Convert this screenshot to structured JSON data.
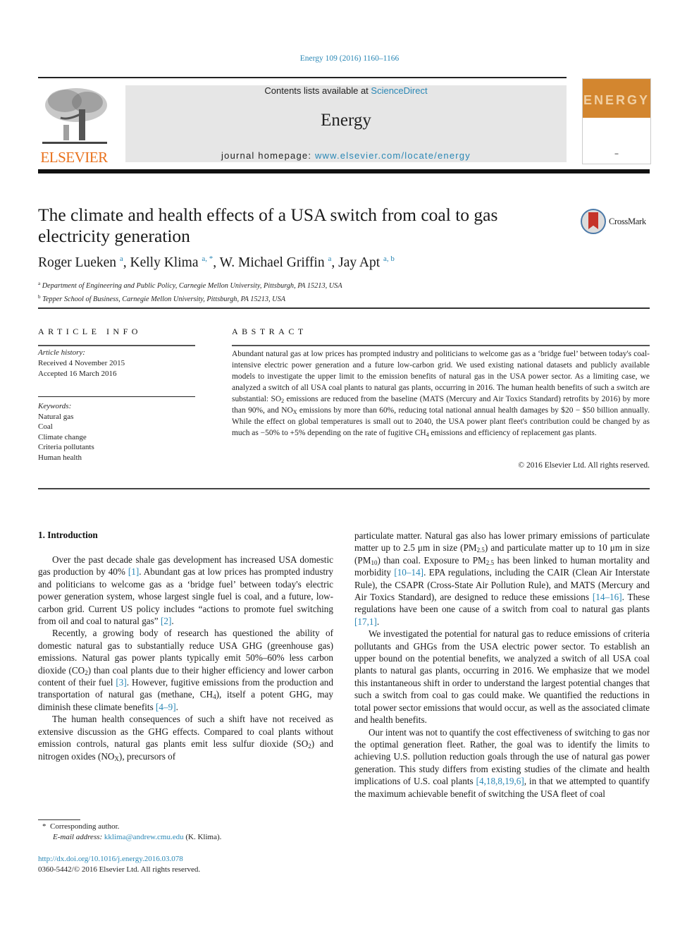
{
  "header": {
    "citation": "Energy 109 (2016) 1160–1166",
    "publisher_logo_text": "ELSEVIER",
    "contents_prefix": "Contents lists available at ",
    "contents_link": "ScienceDirect",
    "journal_name": "Energy",
    "homepage_prefix": "journal homepage: ",
    "homepage_link": "www.elsevier.com/locate/energy",
    "cover_title": "ENERGY",
    "crossmark_label": "CrossMark"
  },
  "article": {
    "title": "The climate and health effects of a USA switch from coal to gas electricity generation",
    "authors": [
      {
        "name": "Roger Lueken",
        "sup": "a"
      },
      {
        "name": "Kelly Klima",
        "sup": "a, *"
      },
      {
        "name": "W. Michael Griffin",
        "sup": "a"
      },
      {
        "name": "Jay Apt",
        "sup": "a, b"
      }
    ],
    "affiliations": [
      {
        "mark": "a",
        "text": "Department of Engineering and Public Policy, Carnegie Mellon University, Pittsburgh, PA 15213, USA"
      },
      {
        "mark": "b",
        "text": "Tepper School of Business, Carnegie Mellon University, Pittsburgh, PA 15213, USA"
      }
    ]
  },
  "article_info": {
    "heading": "ARTICLE INFO",
    "history_label": "Article history:",
    "received": "Received 4 November 2015",
    "accepted": "Accepted 16 March 2016",
    "keywords_label": "Keywords:",
    "keywords": [
      "Natural gas",
      "Coal",
      "Climate change",
      "Criteria pollutants",
      "Human health"
    ]
  },
  "abstract": {
    "heading": "ABSTRACT",
    "parts": {
      "p1": "Abundant natural gas at low prices has prompted industry and politicians to welcome gas as a ‘bridge fuel’ between today's coal-intensive electric power generation and a future low-carbon grid. We used existing national datasets and publicly available models to investigate the upper limit to the emission benefits of natural gas in the USA power sector. As a limiting case, we analyzed a switch of all USA coal plants to natural gas plants, occurring in 2016. The human health benefits of such a switch are substantial: SO",
      "s1": "2",
      "p2": " emissions are reduced from the baseline (MATS (Mercury and Air Toxics Standard) retrofits by 2016) by more than 90%, and NO",
      "s2": "X",
      "p3": " emissions by more than 60%, reducing total national annual health damages by $20 − $50 billion annually. While the effect on global temperatures is small out to 2040, the USA power plant fleet's contribution could be changed by as much as −50% to +5% depending on the rate of fugitive CH",
      "s3": "4",
      "p4": " emissions and efficiency of replacement gas plants."
    },
    "copyright": "© 2016 Elsevier Ltd. All rights reserved."
  },
  "body": {
    "section_heading": "1.  Introduction",
    "left": {
      "p1a": "Over the past decade shale gas development has increased USA domestic gas production by 40% ",
      "r1": "[1]",
      "p1b": ". Abundant gas at low prices has prompted industry and politicians to welcome gas as a ‘bridge fuel’ between today's electric power generation system, whose largest single fuel is coal, and a future, low-carbon grid. Current US policy includes “actions to promote fuel switching from oil and coal to natural gas” ",
      "r2": "[2]",
      "p1c": ".",
      "p2a": "Recently, a growing body of research has questioned the ability of domestic natural gas to substantially reduce USA GHG (greenhouse gas) emissions. Natural gas power plants typically emit 50%–60% less carbon dioxide (CO",
      "p2s1": "2",
      "p2b": ") than coal plants due to their higher efficiency and lower carbon content of their fuel ",
      "r3": "[3]",
      "p2c": ". However, fugitive emissions from the production and transportation of natural gas (methane, CH",
      "p2s2": "4",
      "p2d": "), itself a potent GHG, may diminish these climate benefits ",
      "r4": "[4–9]",
      "p2e": ".",
      "p3a": "The human health consequences of such a shift have not received as extensive discussion as the GHG effects. Compared to coal plants without emission controls, natural gas plants emit less sulfur dioxide (SO",
      "p3s1": "2",
      "p3b": ") and nitrogen oxides (NO",
      "p3s2": "X",
      "p3c": "), precursors of"
    },
    "right": {
      "p1a": "particulate matter. Natural gas also has lower primary emissions of particulate matter up to 2.5 μm in size (PM",
      "p1s1": "2.5",
      "p1b": ") and particulate matter up to 10 μm in size (PM",
      "p1s2": "10",
      "p1c": ") than coal. Exposure to PM",
      "p1s3": "2.5",
      "p1d": " has been linked to human mortality and morbidity ",
      "r1": "[10–14]",
      "p1e": ". EPA regulations, including the CAIR (Clean Air Interstate Rule), the CSAPR (Cross-State Air Pollution Rule), and MATS (Mercury and Air Toxics Standard), are designed to reduce these emissions ",
      "r2": "[14–16]",
      "p1f": ". These regulations have been one cause of a switch from coal to natural gas plants ",
      "r3": "[17,1]",
      "p1g": ".",
      "p2": "We investigated the potential for natural gas to reduce emissions of criteria pollutants and GHGs from the USA electric power sector. To establish an upper bound on the potential benefits, we analyzed a switch of all USA coal plants to natural gas plants, occurring in 2016. We emphasize that we model this instantaneous shift in order to understand the largest potential changes that such a switch from coal to gas could make. We quantified the reductions in total power sector emissions that would occur, as well as the associated climate and health benefits.",
      "p3a": "Our intent was not to quantify the cost effectiveness of switching to gas nor the optimal generation fleet. Rather, the goal was to identify the limits to achieving U.S. pollution reduction goals through the use of natural gas power generation. This study differs from existing studies of the climate and health implications of U.S. coal plants ",
      "r4": "[4,18,8,19,6]",
      "p3b": ", in that we attempted to quantify the maximum achievable benefit of switching the USA fleet of coal"
    }
  },
  "footnotes": {
    "star": "*",
    "corresponding": "Corresponding author.",
    "email_label": "E-mail address:",
    "email": "kklima@andrew.cmu.edu",
    "email_suffix": " (K. Klima).",
    "doi": "http://dx.doi.org/10.1016/j.energy.2016.03.078",
    "issn_line": "0360-5442/© 2016 Elsevier Ltd. All rights reserved."
  }
}
